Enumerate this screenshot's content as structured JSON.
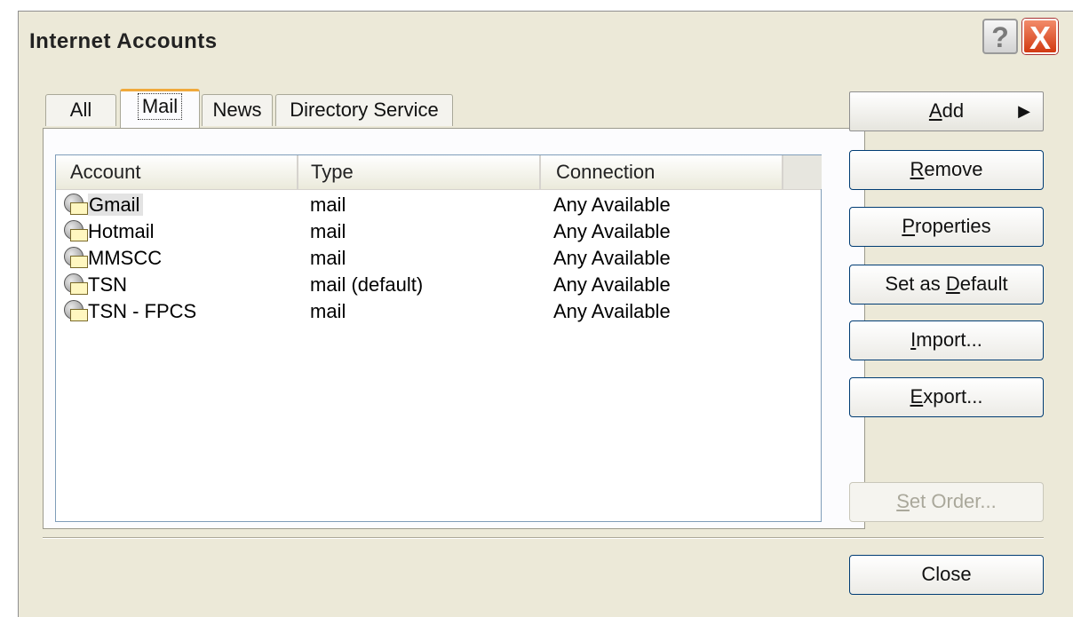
{
  "window": {
    "title": "Internet Accounts",
    "help_glyph": "?",
    "close_glyph": "X"
  },
  "tabs": [
    {
      "label": "All",
      "active": false
    },
    {
      "label": "Mail",
      "active": true
    },
    {
      "label": "News",
      "active": false
    },
    {
      "label": "Directory Service",
      "active": false
    }
  ],
  "list": {
    "columns": [
      "Account",
      "Type",
      "Connection"
    ],
    "rows": [
      {
        "account": "Gmail",
        "type": "mail",
        "connection": "Any Available",
        "selected": true
      },
      {
        "account": "Hotmail",
        "type": "mail",
        "connection": "Any Available",
        "selected": false
      },
      {
        "account": "MMSCC",
        "type": "mail",
        "connection": "Any Available",
        "selected": false
      },
      {
        "account": "TSN",
        "type": "mail (default)",
        "connection": "Any Available",
        "selected": false
      },
      {
        "account": "TSN - FPCS",
        "type": "mail",
        "connection": "Any Available",
        "selected": false
      }
    ],
    "row_icon": "mail-account-icon"
  },
  "buttons": {
    "add": {
      "pre": "",
      "key": "A",
      "post": "dd",
      "arrow": "▶"
    },
    "remove": {
      "pre": "",
      "key": "R",
      "post": "emove"
    },
    "properties": {
      "pre": "",
      "key": "P",
      "post": "roperties"
    },
    "set_default": {
      "pre": "Set as ",
      "key": "D",
      "post": "efault"
    },
    "import": {
      "pre": "",
      "key": "I",
      "post": "mport..."
    },
    "export": {
      "pre": "",
      "key": "E",
      "post": "xport..."
    },
    "set_order": {
      "pre": "",
      "key": "S",
      "post": "et Order...",
      "disabled": true
    },
    "close": {
      "label": "Close"
    }
  },
  "colors": {
    "dialog_bg": "#ece9d8",
    "active_tab_accent": "#f0a93c",
    "button_border": "#003c74",
    "close_button": "#d23a12"
  }
}
